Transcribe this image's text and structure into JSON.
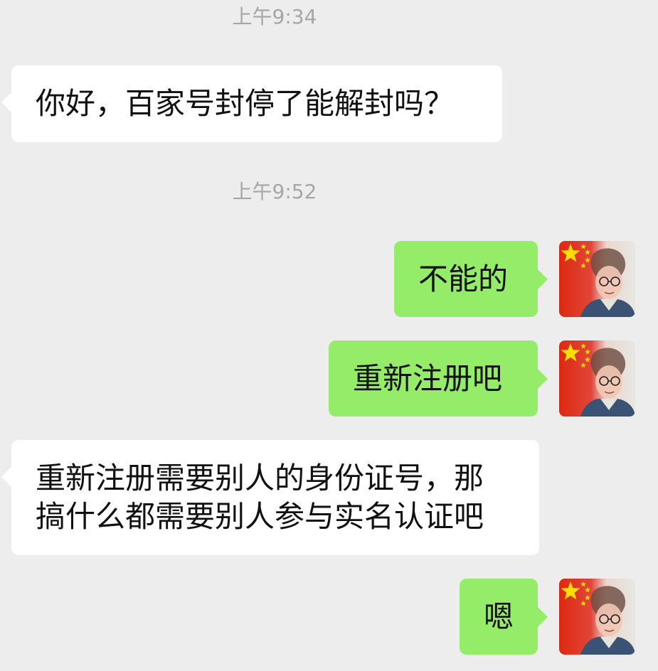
{
  "messages": [
    {
      "type": "timestamp",
      "text": "上午9:34"
    },
    {
      "type": "incoming",
      "text": "你好，百家号封停了能解封吗？"
    },
    {
      "type": "timestamp",
      "text": "上午9:52"
    },
    {
      "type": "outgoing",
      "text": "不能的",
      "avatar": "portrait-with-flag-avatar"
    },
    {
      "type": "outgoing",
      "text": "重新注册吧",
      "avatar": "portrait-with-flag-avatar"
    },
    {
      "type": "incoming",
      "lines": [
        "重新注册需要别人的身份证号，那",
        "搞什么都需要别人参与实名认证吧"
      ]
    },
    {
      "type": "outgoing",
      "text": "嗯",
      "avatar": "portrait-with-flag-avatar"
    }
  ],
  "colors": {
    "background": "#ededed",
    "incoming_bubble": "#ffffff",
    "outgoing_bubble": "#95ec69",
    "timestamp_text": "#a6a6a6",
    "flag_red": "#de2910",
    "flag_star": "#ffde00"
  }
}
